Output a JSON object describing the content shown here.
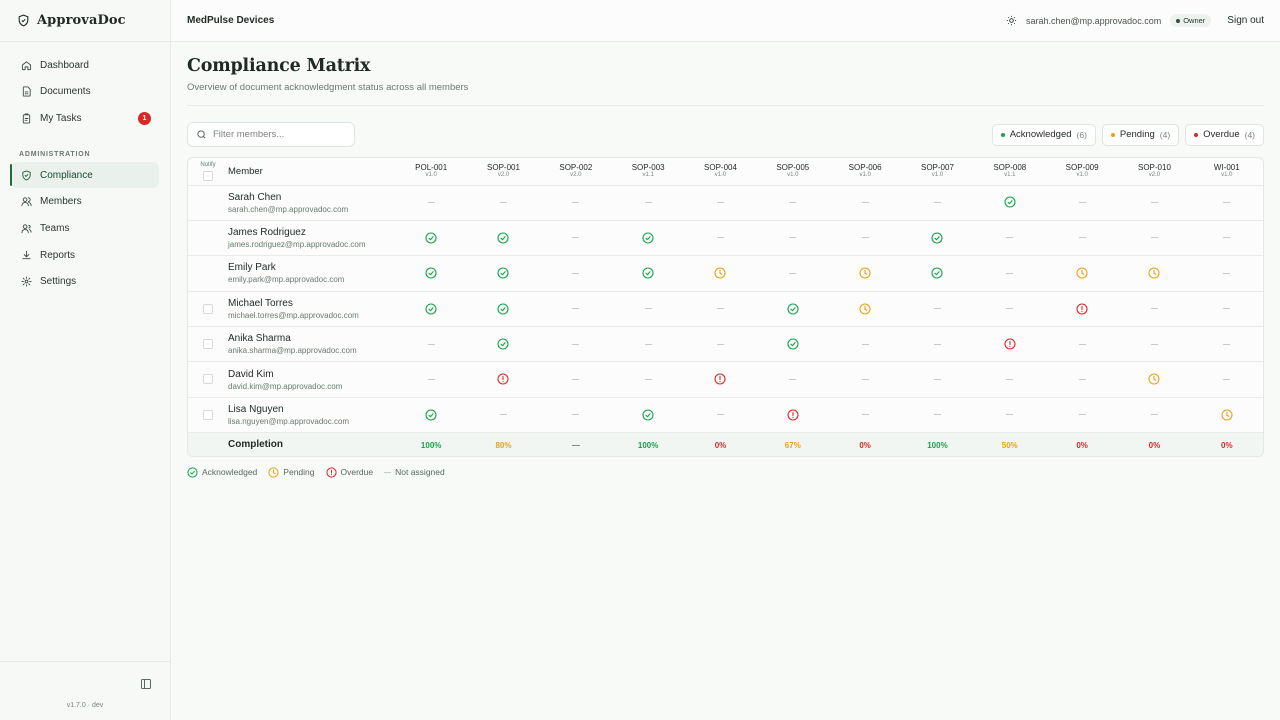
{
  "app": {
    "name": "ApprovaDoc",
    "version": "v1.7.0 · dev"
  },
  "sidebar": {
    "items": [
      {
        "id": "dashboard",
        "label": "Dashboard",
        "icon": "home-icon"
      },
      {
        "id": "documents",
        "label": "Documents",
        "icon": "document-icon"
      },
      {
        "id": "my-tasks",
        "label": "My Tasks",
        "icon": "clipboard-icon",
        "badge": "1"
      }
    ],
    "admin_section": "ADMINISTRATION",
    "admin_items": [
      {
        "id": "compliance",
        "label": "Compliance",
        "icon": "shield-check-icon",
        "active": true
      },
      {
        "id": "members",
        "label": "Members",
        "icon": "users-icon"
      },
      {
        "id": "teams",
        "label": "Teams",
        "icon": "team-icon"
      },
      {
        "id": "reports",
        "label": "Reports",
        "icon": "download-icon"
      },
      {
        "id": "settings",
        "label": "Settings",
        "icon": "gear-icon"
      }
    ]
  },
  "header": {
    "org": "MedPulse Devices",
    "user_email": "sarah.chen@mp.approvadoc.com",
    "role": "Owner",
    "sign_out": "Sign out"
  },
  "page": {
    "title": "Compliance Matrix",
    "subtitle": "Overview of document acknowledgment status across all members"
  },
  "filter": {
    "placeholder": "Filter members..."
  },
  "summary": [
    {
      "label": "Acknowledged",
      "count": "(6)",
      "color": "#16a34a"
    },
    {
      "label": "Pending",
      "count": "(4)",
      "color": "#f59e0b"
    },
    {
      "label": "Overdue",
      "count": "(4)",
      "color": "#dc2626"
    }
  ],
  "colors": {
    "acknowledged": "#16a34a",
    "pending": "#e8a317",
    "overdue": "#dc2626",
    "none": "#c5ccc7"
  },
  "table": {
    "notify_label": "Notify",
    "member_label": "Member",
    "documents": [
      {
        "id": "POL-001",
        "version": "v1.0"
      },
      {
        "id": "SOP-001",
        "version": "v2.0"
      },
      {
        "id": "SOP-002",
        "version": "v2.0"
      },
      {
        "id": "SOP-003",
        "version": "v1.1"
      },
      {
        "id": "SOP-004",
        "version": "v1.0"
      },
      {
        "id": "SOP-005",
        "version": "v1.0"
      },
      {
        "id": "SOP-006",
        "version": "v1.0"
      },
      {
        "id": "SOP-007",
        "version": "v1.0"
      },
      {
        "id": "SOP-008",
        "version": "v1.1"
      },
      {
        "id": "SOP-009",
        "version": "v1.0"
      },
      {
        "id": "SOP-010",
        "version": "v2.0"
      },
      {
        "id": "WI-001",
        "version": "v1.0"
      }
    ],
    "members": [
      {
        "name": "Sarah Chen",
        "email": "sarah.chen@mp.approvadoc.com",
        "checkbox": false,
        "statuses": [
          "none",
          "none",
          "none",
          "none",
          "none",
          "none",
          "none",
          "none",
          "acknowledged",
          "none",
          "none",
          "none"
        ]
      },
      {
        "name": "James Rodriguez",
        "email": "james.rodriguez@mp.approvadoc.com",
        "checkbox": false,
        "statuses": [
          "acknowledged",
          "acknowledged",
          "none",
          "acknowledged",
          "none",
          "none",
          "none",
          "acknowledged",
          "none",
          "none",
          "none",
          "none"
        ]
      },
      {
        "name": "Emily Park",
        "email": "emily.park@mp.approvadoc.com",
        "checkbox": false,
        "statuses": [
          "acknowledged",
          "acknowledged",
          "none",
          "acknowledged",
          "pending",
          "none",
          "pending",
          "acknowledged",
          "none",
          "pending",
          "pending",
          "none"
        ]
      },
      {
        "name": "Michael Torres",
        "email": "michael.torres@mp.approvadoc.com",
        "checkbox": true,
        "statuses": [
          "acknowledged",
          "acknowledged",
          "none",
          "none",
          "none",
          "acknowledged",
          "pending",
          "none",
          "none",
          "overdue",
          "none",
          "none"
        ]
      },
      {
        "name": "Anika Sharma",
        "email": "anika.sharma@mp.approvadoc.com",
        "checkbox": true,
        "statuses": [
          "none",
          "acknowledged",
          "none",
          "none",
          "none",
          "acknowledged",
          "none",
          "none",
          "overdue",
          "none",
          "none",
          "none"
        ]
      },
      {
        "name": "David Kim",
        "email": "david.kim@mp.approvadoc.com",
        "checkbox": true,
        "statuses": [
          "none",
          "overdue",
          "none",
          "none",
          "overdue",
          "none",
          "none",
          "none",
          "none",
          "none",
          "pending",
          "none"
        ]
      },
      {
        "name": "Lisa Nguyen",
        "email": "lisa.nguyen@mp.approvadoc.com",
        "checkbox": true,
        "statuses": [
          "acknowledged",
          "none",
          "none",
          "acknowledged",
          "none",
          "overdue",
          "none",
          "none",
          "none",
          "none",
          "none",
          "pending"
        ]
      }
    ],
    "completion_label": "Completion",
    "completion": [
      {
        "value": "100%",
        "color": "#16a34a"
      },
      {
        "value": "80%",
        "color": "#e8a317"
      },
      {
        "value": "—",
        "color": "#6b7a70"
      },
      {
        "value": "100%",
        "color": "#16a34a"
      },
      {
        "value": "0%",
        "color": "#dc2626"
      },
      {
        "value": "67%",
        "color": "#e8a317"
      },
      {
        "value": "0%",
        "color": "#dc2626"
      },
      {
        "value": "100%",
        "color": "#16a34a"
      },
      {
        "value": "50%",
        "color": "#e8a317"
      },
      {
        "value": "0%",
        "color": "#dc2626"
      },
      {
        "value": "0%",
        "color": "#dc2626"
      },
      {
        "value": "0%",
        "color": "#dc2626"
      }
    ]
  },
  "legend": [
    {
      "status": "acknowledged",
      "label": "Acknowledged"
    },
    {
      "status": "pending",
      "label": "Pending"
    },
    {
      "status": "overdue",
      "label": "Overdue"
    },
    {
      "status": "none",
      "label": "Not assigned"
    }
  ]
}
